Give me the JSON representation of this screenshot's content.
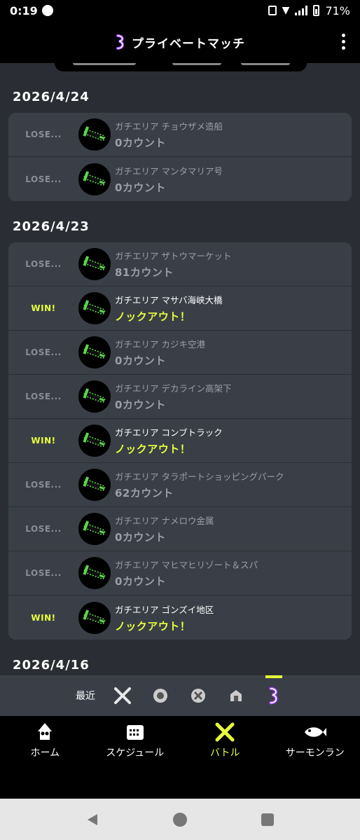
{
  "status": {
    "time": "0:19",
    "battery": "71%"
  },
  "header": {
    "title": "プライベートマッチ"
  },
  "groups": [
    {
      "date": "2026/4/24",
      "matches": [
        {
          "result": "LOSE...",
          "win": false,
          "stage": "ガチエリア チョウザメ造船",
          "count": "0カウント"
        },
        {
          "result": "LOSE...",
          "win": false,
          "stage": "ガチエリア マンタマリア号",
          "count": "0カウント"
        }
      ]
    },
    {
      "date": "2026/4/23",
      "matches": [
        {
          "result": "LOSE...",
          "win": false,
          "stage": "ガチエリア ザトウマーケット",
          "count": "81カウント"
        },
        {
          "result": "WIN!",
          "win": true,
          "stage": "ガチエリア マサバ海峡大橋",
          "count": "ノックアウト！"
        },
        {
          "result": "LOSE...",
          "win": false,
          "stage": "ガチエリア カジキ空港",
          "count": "0カウント"
        },
        {
          "result": "LOSE...",
          "win": false,
          "stage": "ガチエリア デカライン高架下",
          "count": "0カウント"
        },
        {
          "result": "WIN!",
          "win": true,
          "stage": "ガチエリア コンブトラック",
          "count": "ノックアウト！"
        },
        {
          "result": "LOSE...",
          "win": false,
          "stage": "ガチエリア タラポートショッピングパーク",
          "count": "62カウント"
        },
        {
          "result": "LOSE...",
          "win": false,
          "stage": "ガチエリア ナメロウ金属",
          "count": "0カウント"
        },
        {
          "result": "LOSE...",
          "win": false,
          "stage": "ガチエリア マヒマヒリゾート＆スパ",
          "count": "0カウント"
        },
        {
          "result": "WIN!",
          "win": true,
          "stage": "ガチエリア ゴンズイ地区",
          "count": "ノックアウト！"
        }
      ]
    },
    {
      "date": "2026/4/16",
      "matches": []
    }
  ],
  "filter": {
    "label": "最近",
    "icons": [
      "regular-battle-icon",
      "anarchy-battle-icon",
      "x-battle-icon",
      "event-battle-icon",
      "private-battle-icon"
    ],
    "selected": 4
  },
  "nav": [
    {
      "label": "ホーム",
      "icon": "squid-home-icon"
    },
    {
      "label": "スケジュール",
      "icon": "calendar-icon"
    },
    {
      "label": "バトル",
      "icon": "battle-icon",
      "active": true
    },
    {
      "label": "サーモンラン",
      "icon": "salmon-icon"
    }
  ],
  "colors": {
    "accent": "#e8ff3c",
    "card": "#3a3f47",
    "bg": "#2a2d33"
  }
}
